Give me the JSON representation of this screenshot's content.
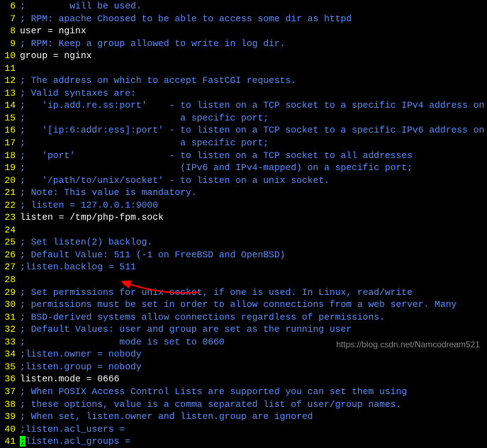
{
  "lines": [
    {
      "n": "6",
      "seg": [
        {
          "c": "blue",
          "t": ";        will be used."
        }
      ]
    },
    {
      "n": "7",
      "seg": [
        {
          "c": "blue",
          "t": "; RPM: apache Choosed to be able to access some dir as httpd"
        }
      ]
    },
    {
      "n": "8",
      "seg": [
        {
          "c": "white",
          "t": "user = nginx"
        }
      ]
    },
    {
      "n": "9",
      "seg": [
        {
          "c": "blue",
          "t": "; RPM: Keep a group allowed to write in log dir."
        }
      ]
    },
    {
      "n": "10",
      "seg": [
        {
          "c": "white",
          "t": "group = nginx"
        }
      ]
    },
    {
      "n": "11",
      "seg": []
    },
    {
      "n": "12",
      "seg": [
        {
          "c": "blue",
          "t": "; The address on which to accept FastCGI requests."
        }
      ]
    },
    {
      "n": "13",
      "seg": [
        {
          "c": "blue",
          "t": "; Valid syntaxes are:"
        }
      ]
    },
    {
      "n": "14",
      "seg": [
        {
          "c": "blue",
          "t": ";   'ip.add.re.ss:port'    - to listen on a TCP socket to a specific IPv4 address on"
        }
      ]
    },
    {
      "n": "15",
      "seg": [
        {
          "c": "blue",
          "t": ";                            a specific port;"
        }
      ]
    },
    {
      "n": "16",
      "seg": [
        {
          "c": "blue",
          "t": ";   '[ip:6:addr:ess]:port' - to listen on a TCP socket to a specific IPv6 address on"
        }
      ]
    },
    {
      "n": "17",
      "seg": [
        {
          "c": "blue",
          "t": ";                            a specific port;"
        }
      ]
    },
    {
      "n": "18",
      "seg": [
        {
          "c": "blue",
          "t": ";   'port'                 - to listen on a TCP socket to all addresses"
        }
      ]
    },
    {
      "n": "19",
      "seg": [
        {
          "c": "blue",
          "t": ";                            (IPv6 and IPv4-mapped) on a specific port;"
        }
      ]
    },
    {
      "n": "20",
      "seg": [
        {
          "c": "blue",
          "t": ";   '/path/to/unix/socket' - to listen on a unix socket."
        }
      ]
    },
    {
      "n": "21",
      "seg": [
        {
          "c": "blue",
          "t": "; Note: This value is mandatory."
        }
      ]
    },
    {
      "n": "22",
      "seg": [
        {
          "c": "blue",
          "t": "; listen = 127.0.0.1:9000"
        }
      ]
    },
    {
      "n": "23",
      "seg": [
        {
          "c": "white",
          "t": "listen = /tmp/php-fpm.sock"
        }
      ]
    },
    {
      "n": "24",
      "seg": []
    },
    {
      "n": "25",
      "seg": [
        {
          "c": "blue",
          "t": "; Set listen(2) backlog."
        }
      ]
    },
    {
      "n": "26",
      "seg": [
        {
          "c": "blue",
          "t": "; Default Value: 511 (-1 on FreeBSD and OpenBSD)"
        }
      ]
    },
    {
      "n": "27",
      "seg": [
        {
          "c": "blue",
          "t": ";listen.backlog = 511"
        }
      ]
    },
    {
      "n": "28",
      "seg": []
    },
    {
      "n": "29",
      "seg": [
        {
          "c": "blue",
          "t": "; Set permissions for unix socket, if one is used. In Linux, read/write"
        }
      ]
    },
    {
      "n": "30",
      "seg": [
        {
          "c": "blue",
          "t": "; permissions must be set in order to allow connections from a web server. Many"
        }
      ]
    },
    {
      "n": "31",
      "seg": [
        {
          "c": "blue",
          "t": "; BSD-derived systems allow connections regardless of permissions."
        }
      ]
    },
    {
      "n": "32",
      "seg": [
        {
          "c": "blue",
          "t": "; Default Values: user and group are set as the running user"
        }
      ]
    },
    {
      "n": "33",
      "seg": [
        {
          "c": "blue",
          "t": ";                 mode is set to 0660"
        }
      ]
    },
    {
      "n": "34",
      "seg": [
        {
          "c": "blue",
          "t": ";listen.owner = nobody"
        }
      ]
    },
    {
      "n": "35",
      "seg": [
        {
          "c": "blue",
          "t": ";listen.group = nobody"
        }
      ]
    },
    {
      "n": "36",
      "seg": [
        {
          "c": "white",
          "t": "listen.mode = 0666"
        }
      ]
    },
    {
      "n": "37",
      "seg": [
        {
          "c": "blue",
          "t": "; When POSIX Access Control Lists are supported you can set them using"
        }
      ]
    },
    {
      "n": "38",
      "seg": [
        {
          "c": "blue",
          "t": "; these options, value is a comma separated list of user/group names."
        }
      ]
    },
    {
      "n": "39",
      "seg": [
        {
          "c": "blue",
          "t": "; When set, listen.owner and listen.group are ignored"
        }
      ]
    },
    {
      "n": "40",
      "seg": [
        {
          "c": "blue",
          "t": ";listen.acl_users ="
        }
      ]
    },
    {
      "n": "41",
      "seg": [
        {
          "c": "blue",
          "t": ""
        },
        {
          "c": "green-cursor",
          "t": ";"
        },
        {
          "c": "blue",
          "t": "listen.acl_groups ="
        }
      ]
    }
  ],
  "watermark": "https://blog.csdn.net/Namcodream521"
}
